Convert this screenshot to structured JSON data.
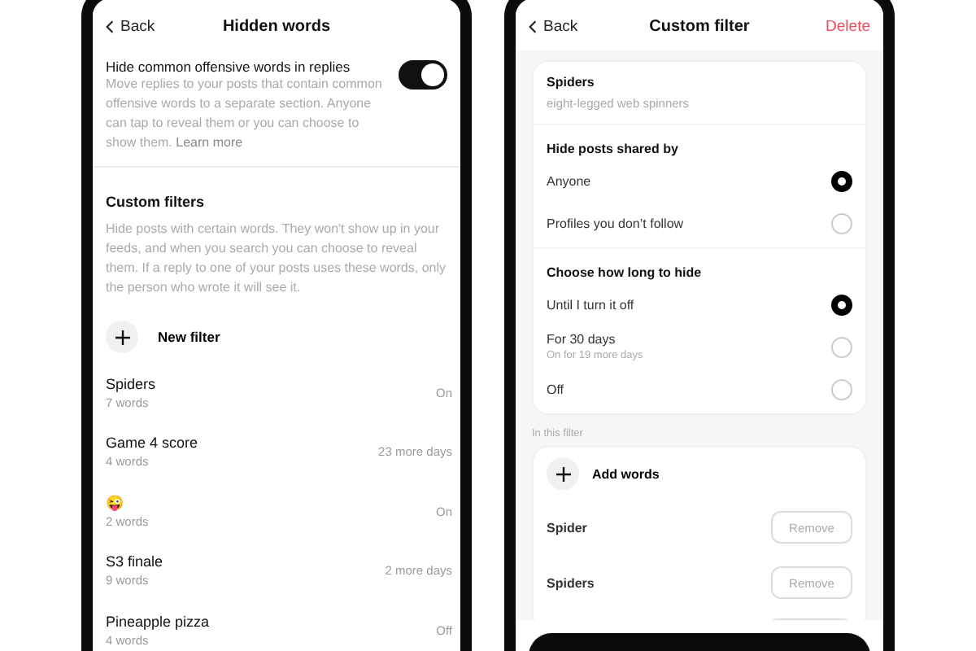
{
  "hidden_words_screen": {
    "back": "Back",
    "title": "Hidden words",
    "offensive_toggle": {
      "label": "Hide common offensive words in replies",
      "description": "Move replies to your posts that contain common offensive words to a separate section. Anyone can tap to reveal them or you can choose to show them.",
      "link": "Learn more",
      "on": true
    },
    "custom_filters": {
      "title": "Custom filters",
      "description": "Hide posts with certain words. They won't show up in your feeds, and when you search you can choose to reveal them. If a reply to one of your posts uses these words, only the person who wrote it will see it.",
      "new_filter": "New filter",
      "filters": [
        {
          "name": "Spiders",
          "count": "7 words",
          "status": "On"
        },
        {
          "name": "Game 4 score",
          "count": "4 words",
          "status": "23 more days"
        },
        {
          "name": "😜",
          "count": "2 words",
          "status": "On"
        },
        {
          "name": "S3 finale",
          "count": "9 words",
          "status": "2 more days"
        },
        {
          "name": "Pineapple pizza",
          "count": "4 words",
          "status": "Off"
        }
      ]
    }
  },
  "custom_filter_screen": {
    "back": "Back",
    "title": "Custom filter",
    "delete": "Delete",
    "filter_name": "Spiders",
    "filter_description": "eight-legged web spinners",
    "shared_by": {
      "title": "Hide posts shared by",
      "options": [
        {
          "label": "Anyone",
          "selected": true
        },
        {
          "label": "Profiles you don’t follow",
          "selected": false
        }
      ]
    },
    "duration": {
      "title": "Choose how long to hide",
      "options": [
        {
          "label": "Until I turn it off",
          "selected": true
        },
        {
          "label": "For 30 days",
          "sublabel": "On for 19 more days",
          "selected": false
        },
        {
          "label": "Off",
          "selected": false
        }
      ]
    },
    "words_section": "In this filter",
    "add_words": "Add words",
    "words": [
      {
        "word": "Spider",
        "action": "Remove"
      },
      {
        "word": "Spiders",
        "action": "Remove"
      }
    ]
  }
}
